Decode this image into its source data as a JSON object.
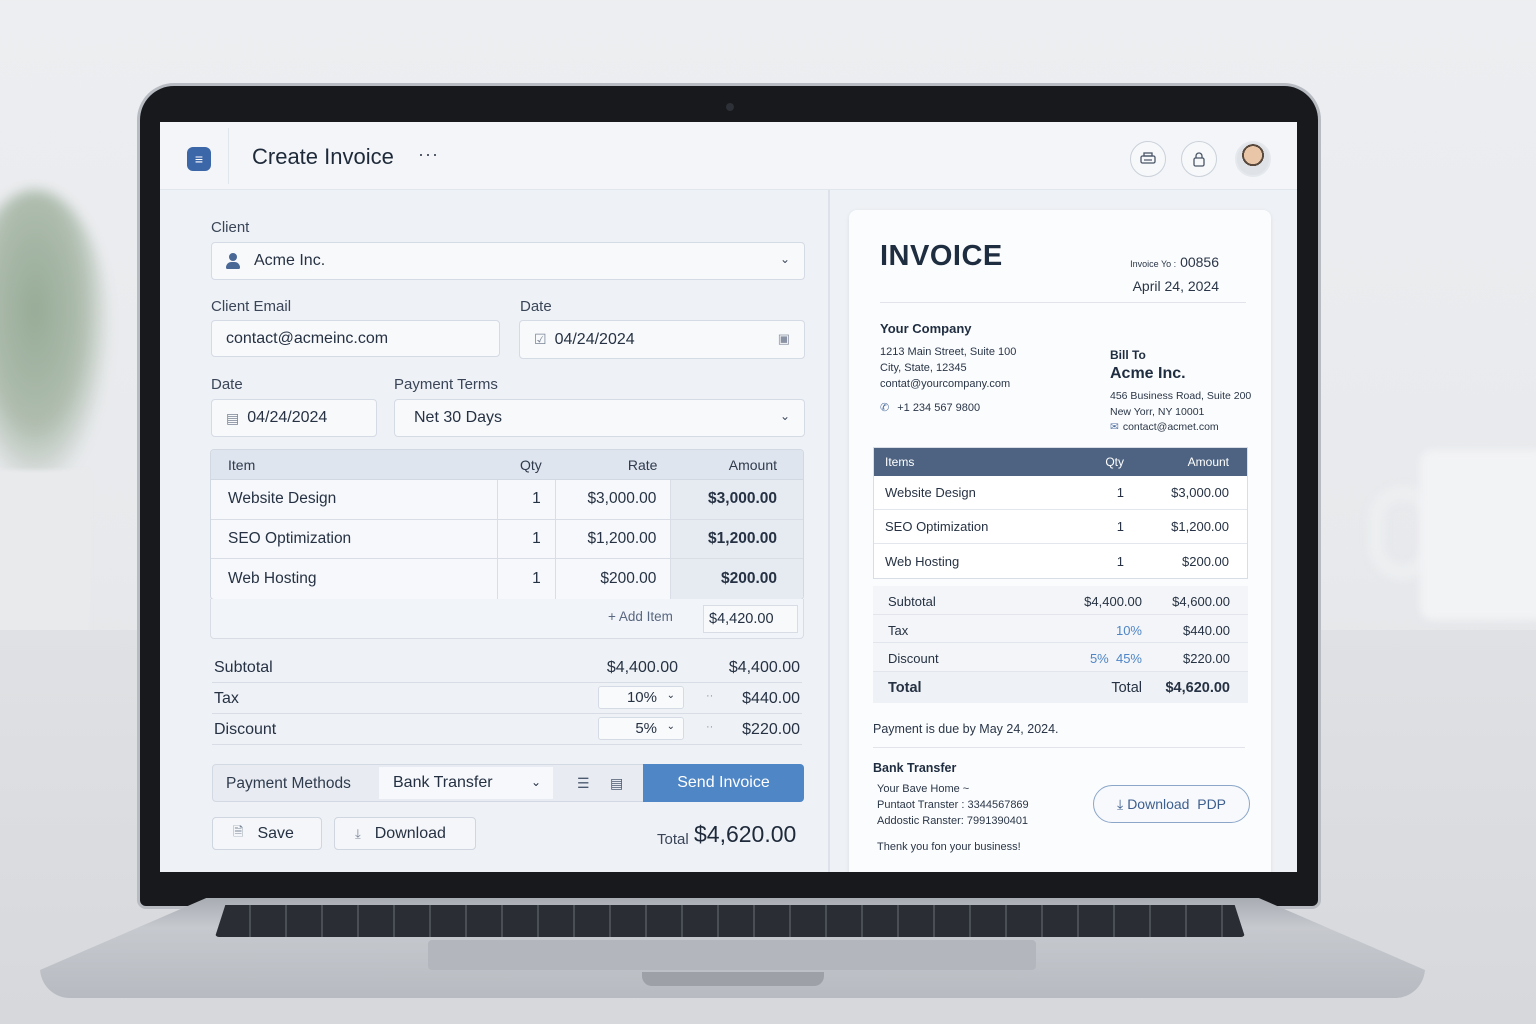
{
  "app": {
    "title": "Create Invoice",
    "more_glyph": "···",
    "icons": {
      "menu": "menu-icon",
      "printer": "printer-icon",
      "lock": "lock-icon",
      "avatar": "user-avatar"
    }
  },
  "form": {
    "client_label": "Client",
    "client_value": "Acme Inc.",
    "client_email_label": "Client Email",
    "client_email_value": "contact@acmeinc.com",
    "date_label_top": "Date",
    "date_value_top": "04/24/2024",
    "date_label": "Date",
    "date_value": "04/24/2024",
    "payment_terms_label": "Payment Terms",
    "payment_terms_value": "Net 30 Days",
    "items_table": {
      "headers": [
        "Item",
        "Qty",
        "Rate",
        "Amount"
      ],
      "rows": [
        {
          "item": "Website Design",
          "qty": "1",
          "rate": "$3,000.00",
          "amount": "$3,000.00"
        },
        {
          "item": "SEO Optimization",
          "qty": "1",
          "rate": "$1,200.00",
          "amount": "$1,200.00"
        },
        {
          "item": "Web Hosting",
          "qty": "1",
          "rate": "$200.00",
          "amount": "$200.00"
        }
      ]
    },
    "add_item_label": "+ Add Item",
    "add_item_amount": "$4,420.00",
    "subtotal_label": "Subtotal",
    "subtotal_mid": "$4,400.00",
    "subtotal_value": "$4,400.00",
    "tax_label": "Tax",
    "tax_rate": "10%",
    "tax_value": "$440.00",
    "discount_label": "Discount",
    "discount_rate": "5%",
    "discount_value": "$220.00",
    "separator_glyph": "··",
    "payment_methods_label": "Payment Methods",
    "payment_method_value": "Bank Transfer",
    "send_invoice_label": "Send Invoice",
    "save_label": "Save",
    "download_label": "Download",
    "total_label": "Total",
    "total_value": "$4,620.00"
  },
  "preview": {
    "title": "INVOICE",
    "invoice_no_label": "Invoice Yo :",
    "invoice_no": "00856",
    "date": "April 24, 2024",
    "from_heading": "Your Company",
    "from_lines": [
      "1213 Main Street, Suite 100",
      "City, State, 12345",
      "contat@yourcompany.com"
    ],
    "from_phone": "+1 234 567 9800",
    "bill_to_label": "Bill To",
    "bill_to_name": "Acme Inc.",
    "bill_to_lines": [
      "456 Business Road, Suite 200",
      "New Yorr, NY 10001"
    ],
    "bill_to_email": "contact@acmet.com",
    "table": {
      "headers": [
        "Items",
        "Qty",
        "Amount"
      ],
      "rows": [
        {
          "item": "Website Design",
          "qty": "1",
          "amount": "$3,000.00"
        },
        {
          "item": "SEO Optimization",
          "qty": "1",
          "amount": "$1,200.00"
        },
        {
          "item": "Web Hosting",
          "qty": "1",
          "amount": "$200.00"
        }
      ]
    },
    "summary": {
      "subtotal_label": "Subtotal",
      "subtotal_mid": "$4,400.00",
      "subtotal_value": "$4,600.00",
      "tax_label": "Tax",
      "tax_rate": "10%",
      "tax_value": "$440.00",
      "discount_label": "Discount",
      "discount_rate": "5%  45%",
      "discount_value": "$220.00",
      "total_label": "Total",
      "total_mid": "Total",
      "total_value": "$4,620.00"
    },
    "due_note": "Payment is due by May 24, 2024.",
    "bank_heading": "Bank Transfer",
    "bank_lines": [
      "Your Bave Home  ~",
      "Puntaot Transter : 3344567869",
      "Addostic Ranster: 7991390401"
    ],
    "thanks": "Thenk you fon your business!",
    "download_pdf_label": "Download  PDP"
  },
  "colors": {
    "accent": "#4f86c6",
    "header_navy": "#4d6381",
    "brand_blue": "#3b66a8"
  }
}
